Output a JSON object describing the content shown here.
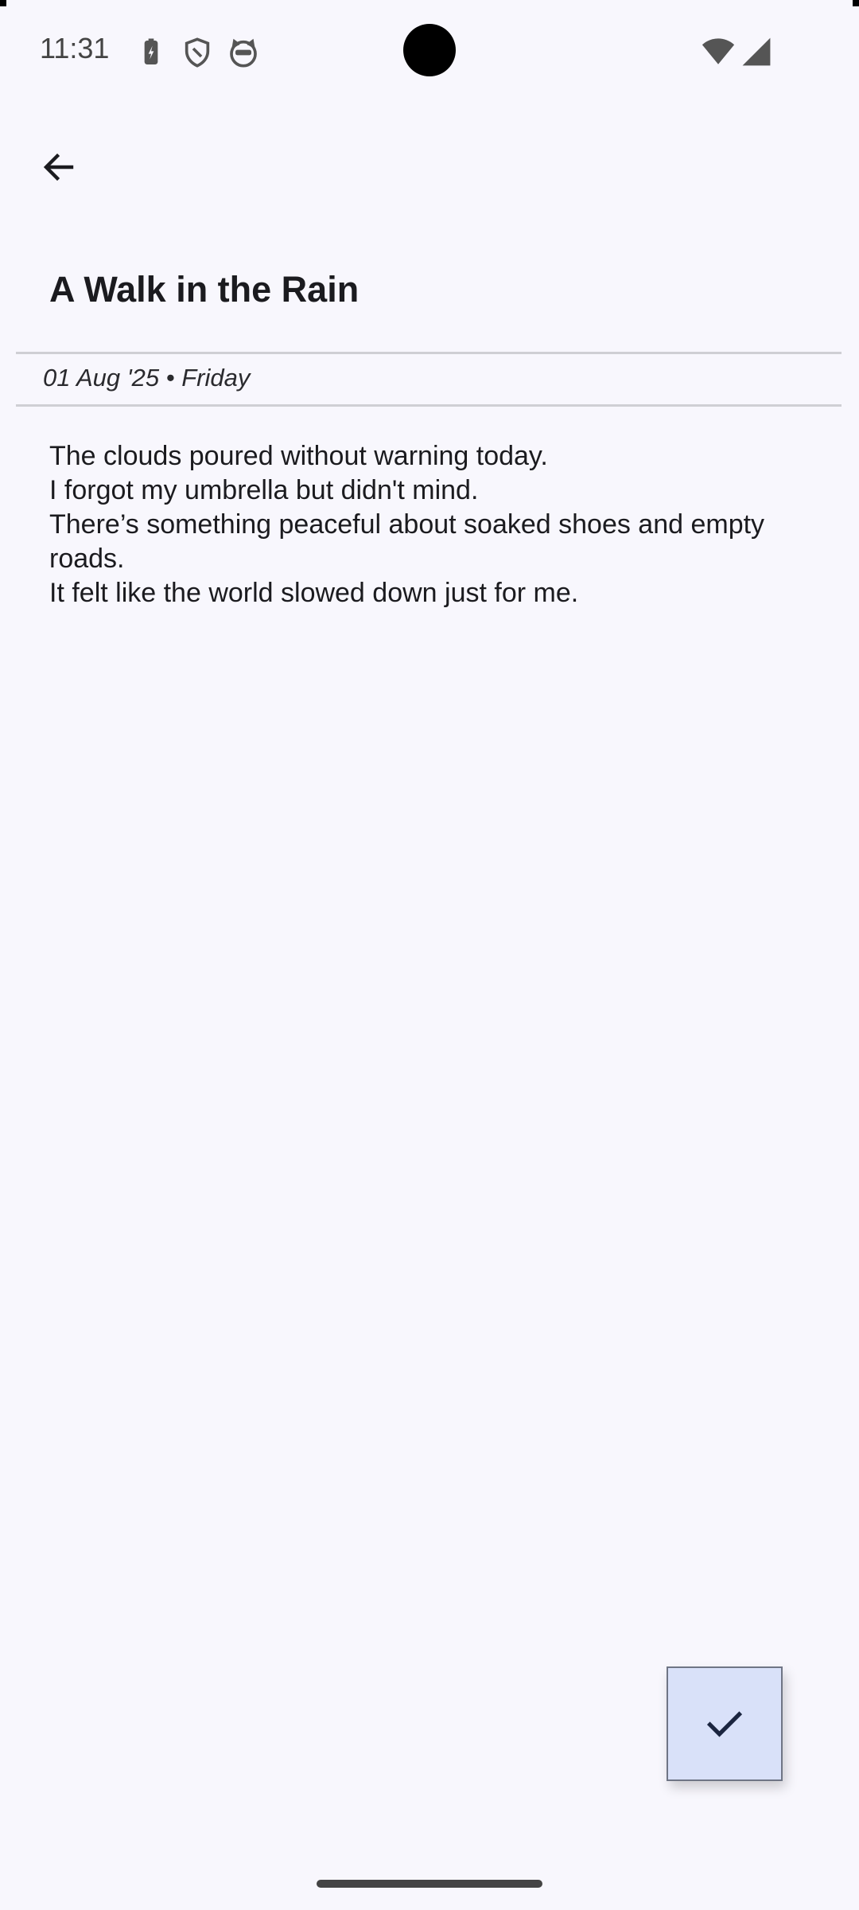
{
  "status_bar": {
    "time": "11:31",
    "left_icons": [
      "battery-saver-icon",
      "shield-icon",
      "cat-face-icon"
    ],
    "right_icons": [
      "wifi-icon",
      "cellular-signal-icon"
    ]
  },
  "toolbar": {
    "back_icon": "arrow-back-icon"
  },
  "entry": {
    "title": "A Walk in the Rain",
    "date": "01 Aug '25 • Friday",
    "lines": [
      "The clouds poured without warning today.",
      "I forgot my umbrella but didn't mind.",
      "There’s something peaceful about soaked shoes and empty roads.",
      "It felt like the world slowed down just for me."
    ]
  },
  "fab": {
    "icon": "check-icon",
    "color": "#d9e1f9"
  }
}
